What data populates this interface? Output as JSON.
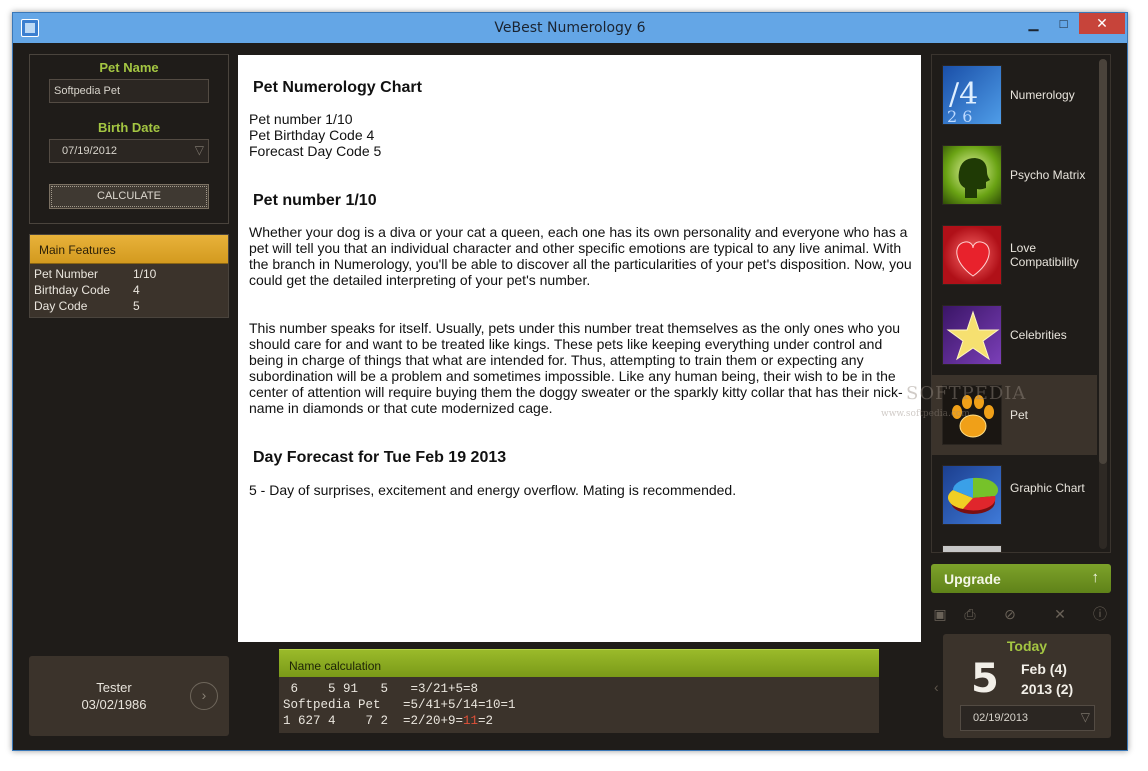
{
  "window": {
    "title": "VeBest Numerology 6",
    "minimize": "▁",
    "maximize": "□",
    "close": "✕"
  },
  "left": {
    "pet_name_label": "Pet Name",
    "pet_name_value": "Softpedia Pet",
    "birth_date_label": "Birth Date",
    "birth_date_value": "07/19/2012",
    "calculate_label": "CALCULATE",
    "features": {
      "header": "Main Features",
      "rows": [
        {
          "key": "Pet Number",
          "value": "1/10"
        },
        {
          "key": "Birthday Code",
          "value": "4"
        },
        {
          "key": "Day Code",
          "value": "5"
        }
      ]
    },
    "user": {
      "name": "Tester",
      "date": "03/02/1986"
    }
  },
  "content": {
    "heading1": "Pet Numerology Chart",
    "summary": [
      "Pet number 1/10",
      "Pet Birthday Code 4",
      "Forecast Day Code 5"
    ],
    "heading2": "Pet number 1/10",
    "para1": "Whether your dog is a diva or your cat a queen, each one has its own personality and everyone who has a pet will tell you that an individual character and other specific emotions are typical to any live animal. With the branch in Numerology, you'll be able to discover all the particularities of your pet's disposition. Now, you could get the detailed interpreting of your pet's number.",
    "para2": "This number speaks for itself. Usually, pets under this number treat themselves as the only ones who you should care for and want to be treated like kings. These pets like keeping everything under control and being in charge of things that what are intended for. Thus, attempting to train them or expecting any subordination will be a problem and sometimes impossible. Like any human being, their wish to be in the center of attention will require buying them the doggy sweater or the sparkly kitty collar that has their nick-name in diamonds or that cute modernized cage.",
    "heading3": "Day Forecast for Tue Feb 19 2013",
    "forecast": "5 - Day of surprises, excitement and energy overflow. Mating is recommended."
  },
  "name_calc": {
    "header": "Name calculation",
    "row1": " 6    5 91   5   =3/21+5=8",
    "row2": "Softpedia Pet   =5/41+5/14=10=1",
    "row3a": "1 627 4    7 2  =2/20+9=",
    "row3b": "11",
    "row3c": "=2"
  },
  "modules": [
    {
      "label": "Numerology",
      "icon": "numerology-icon"
    },
    {
      "label": "Psycho Matrix",
      "icon": "psycho-matrix-icon"
    },
    {
      "label": "Love Compatibility",
      "icon": "heart-icon"
    },
    {
      "label": "Celebrities",
      "icon": "star-icon"
    },
    {
      "label": "Pet",
      "icon": "paw-icon"
    },
    {
      "label": "Graphic Chart",
      "icon": "pie-chart-icon"
    }
  ],
  "upgrade_label": "Upgrade",
  "upgrade_arrow": "↑",
  "tools": [
    "save-icon",
    "print-icon",
    "cancel-icon",
    "tools-icon",
    "info-icon"
  ],
  "today": {
    "label": "Today",
    "day": "5",
    "line1": "Feb (4)",
    "line2": "2013 (2)",
    "date": "02/19/2013"
  },
  "watermark": "SOFTPEDIA",
  "watermark_url": "www.softpedia.com",
  "colors": {
    "accent_green": "#a4c642",
    "features_gold": "#e0a82d",
    "upgrade_green": "#6e9222",
    "panel_bg": "#3b332b",
    "window_bg": "#1f1c19"
  }
}
